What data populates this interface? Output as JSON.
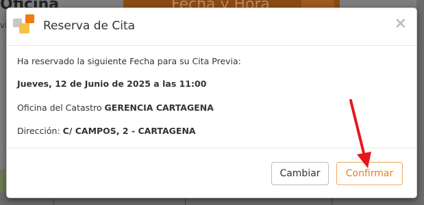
{
  "background": {
    "title": "Oficina",
    "subtitle": "vi",
    "orange_banner": "Fecha y Hora"
  },
  "modal": {
    "title": "Reserva de Cita",
    "close_symbol": "×",
    "intro": "Ha reservado la siguiente Fecha para su Cita Previa:",
    "date_line": "Jueves, 12 de Junio de 2025 a las 11:00",
    "office_label": "Oficina del Catastro",
    "office_value": "GERENCIA CARTAGENA",
    "address_label": "Dirección:",
    "address_value": "C/ CAMPOS, 2 - CARTAGENA",
    "cancel_label": "Cambiar",
    "confirm_label": "Confirmar"
  },
  "colors": {
    "logo_orange": "#f07d0a",
    "logo_gray": "#c8c8c8",
    "logo_yellow": "#f7c24a",
    "confirm_border": "#f0a85a",
    "confirm_text": "#e67e22",
    "arrow": "#e8161a"
  },
  "icons": {
    "logo": "catastro-logo-icon",
    "close": "close-icon",
    "annotation": "red-arrow-annotation"
  }
}
